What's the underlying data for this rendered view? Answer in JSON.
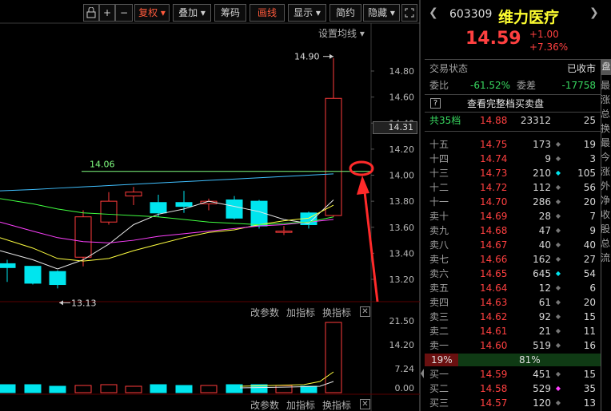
{
  "toolbar": {
    "buttons": [
      {
        "label": "复权",
        "active": true,
        "dropdown": true
      },
      {
        "label": "叠加",
        "active": false,
        "dropdown": true
      },
      {
        "label": "筹码",
        "active": false,
        "dropdown": false
      },
      {
        "label": "画线",
        "active": true,
        "dropdown": false
      },
      {
        "label": "显示",
        "active": false,
        "dropdown": true
      },
      {
        "label": "简约",
        "active": false,
        "dropdown": false
      },
      {
        "label": "隐藏",
        "active": false,
        "dropdown": true
      }
    ],
    "icons": [
      "lock-icon",
      "plus-icon",
      "minus-icon",
      "expand-icon"
    ]
  },
  "main_chart": {
    "settings_label": "设置均线",
    "hline_label": "14.06",
    "max_label": "14.90",
    "min_label": "13.13",
    "y_ticks": [
      "14.80",
      "14.60",
      "14.40",
      "14.20",
      "14.00",
      "13.80",
      "13.60",
      "13.40",
      "13.20"
    ],
    "current_price_tag": "14.31"
  },
  "chart_data": {
    "type": "candlestick",
    "y_range": [
      13.1,
      14.95
    ],
    "candles": [
      {
        "o": 13.32,
        "c": 13.29,
        "h": 13.35,
        "l": 13.18
      },
      {
        "o": 13.3,
        "c": 13.17,
        "h": 13.3,
        "l": 13.16
      },
      {
        "o": 13.26,
        "c": 13.16,
        "h": 13.27,
        "l": 13.13
      },
      {
        "o": 13.37,
        "c": 13.68,
        "h": 13.73,
        "l": 13.3
      },
      {
        "o": 13.64,
        "c": 13.8,
        "h": 13.87,
        "l": 13.62
      },
      {
        "o": 13.84,
        "c": 13.87,
        "h": 13.91,
        "l": 13.77
      },
      {
        "o": 13.79,
        "c": 13.71,
        "h": 13.85,
        "l": 13.68
      },
      {
        "o": 13.79,
        "c": 13.76,
        "h": 13.88,
        "l": 13.71
      },
      {
        "o": 13.78,
        "c": 13.8,
        "h": 13.82,
        "l": 13.73
      },
      {
        "o": 13.81,
        "c": 13.67,
        "h": 13.84,
        "l": 13.66
      },
      {
        "o": 13.8,
        "c": 13.61,
        "h": 13.81,
        "l": 13.59
      },
      {
        "o": 13.57,
        "c": 13.57,
        "h": 13.61,
        "l": 13.54
      },
      {
        "o": 13.71,
        "c": 13.62,
        "h": 13.72,
        "l": 13.59
      },
      {
        "o": 13.69,
        "c": 14.59,
        "h": 14.9,
        "l": 13.68
      }
    ]
  },
  "indicator_panel_1": {
    "buttons": [
      "改参数",
      "加指标",
      "换指标"
    ],
    "y_ticks": [
      "21.50",
      "14.20",
      "7.24",
      "0.00"
    ]
  },
  "indicator_panel_2": {
    "buttons": [
      "改参数",
      "加指标",
      "换指标"
    ]
  },
  "quote": {
    "code": "603309",
    "name": "维力医疗",
    "price": "14.59",
    "change": "+1.00",
    "change_pct": "+7.36%",
    "status_label": "交易状态",
    "status_value": "已收市",
    "weibi_label": "委比",
    "weibi_value": "-61.52%",
    "weicha_label": "委差",
    "weicha_value": "-17758",
    "full_book_label": "查看完整档买卖盘",
    "help_icon": "?",
    "total_row": {
      "label": "共35档",
      "price": "14.88",
      "vol": "23312",
      "count": "25"
    },
    "asks": [
      {
        "level": "十五",
        "price": "14.75",
        "vol": "173",
        "dot": "gray",
        "count": "19"
      },
      {
        "level": "十四",
        "price": "14.74",
        "vol": "9",
        "dot": "gray",
        "count": "3"
      },
      {
        "level": "十三",
        "price": "14.73",
        "vol": "210",
        "dot": "cyan",
        "count": "105"
      },
      {
        "level": "十二",
        "price": "14.72",
        "vol": "112",
        "dot": "gray",
        "count": "56"
      },
      {
        "level": "十一",
        "price": "14.70",
        "vol": "286",
        "dot": "gray",
        "count": "20"
      },
      {
        "level": "卖十",
        "price": "14.69",
        "vol": "28",
        "dot": "gray",
        "count": "7"
      },
      {
        "level": "卖九",
        "price": "14.68",
        "vol": "47",
        "dot": "gray",
        "count": "9"
      },
      {
        "level": "卖八",
        "price": "14.67",
        "vol": "40",
        "dot": "gray",
        "count": "40"
      },
      {
        "level": "卖七",
        "price": "14.66",
        "vol": "162",
        "dot": "gray",
        "count": "27"
      },
      {
        "level": "卖六",
        "price": "14.65",
        "vol": "645",
        "dot": "cyan",
        "count": "54"
      },
      {
        "level": "卖五",
        "price": "14.64",
        "vol": "12",
        "dot": "gray",
        "count": "6"
      },
      {
        "level": "卖四",
        "price": "14.63",
        "vol": "61",
        "dot": "gray",
        "count": "20"
      },
      {
        "level": "卖三",
        "price": "14.62",
        "vol": "92",
        "dot": "gray",
        "count": "15"
      },
      {
        "level": "卖二",
        "price": "14.61",
        "vol": "21",
        "dot": "gray",
        "count": "11"
      },
      {
        "level": "卖一",
        "price": "14.60",
        "vol": "519",
        "dot": "gray",
        "count": "16"
      }
    ],
    "ratio": {
      "left": "19%",
      "right": "81%",
      "left_frac": 0.19
    },
    "bids": [
      {
        "level": "买一",
        "price": "14.59",
        "vol": "451",
        "dot": "gray",
        "count": "15"
      },
      {
        "level": "买二",
        "price": "14.58",
        "vol": "529",
        "dot": "magenta",
        "count": "35"
      },
      {
        "level": "买三",
        "price": "14.57",
        "vol": "120",
        "dot": "gray",
        "count": "13"
      }
    ],
    "edge_tab": "盘",
    "edge_chars": [
      "最",
      "涨",
      "总",
      "换",
      "最",
      "今",
      "涨",
      "外",
      "净",
      "收",
      "股",
      "总",
      "流"
    ]
  },
  "colors": {
    "up": "#ff3b3b",
    "down": "#00e5ee",
    "accent": "#ff5a3c",
    "ma5": "#e8e8e8",
    "ma10": "#ffff40",
    "ma20": "#ff40ff",
    "ma30": "#40ff40",
    "ma60": "#40c0ff",
    "hline": "#80ff80"
  }
}
